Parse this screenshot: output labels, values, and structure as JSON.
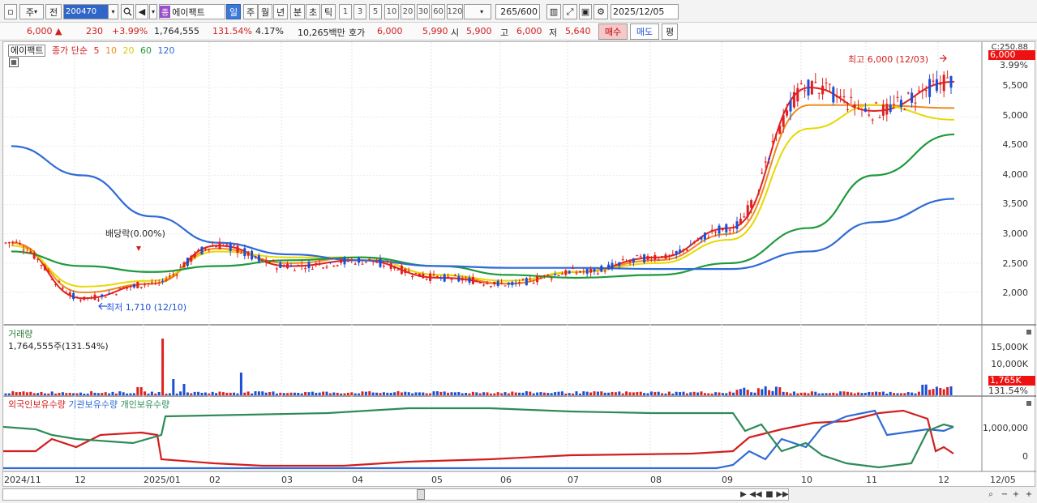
{
  "toolbar": {
    "market_type": "주",
    "prev_label": "전",
    "stock_code": "200470",
    "stock_tag": "종",
    "stock_name": "에이팩트",
    "periods": [
      "일",
      "주",
      "월",
      "년",
      "분",
      "초",
      "틱"
    ],
    "active_period": "일",
    "intervals": [
      "1",
      "3",
      "5",
      "10",
      "20",
      "30",
      "60",
      "120"
    ],
    "count": "265",
    "count_total": "/600",
    "date": "2025/12/05"
  },
  "quote": {
    "price": "6,000",
    "change_arrow": "▲",
    "change": "230",
    "change_pct": "+3.99%",
    "volume": "1,764,555",
    "volume_ratio": "131.54%",
    "turnover_pct": "4.17%",
    "amount": "10,265백만",
    "ask_label": "호가",
    "ask1": "6,000",
    "ask2": "5,990",
    "open_label": "시",
    "open": "5,900",
    "high_label": "고",
    "high": "6,000",
    "low_label": "저",
    "low": "5,640",
    "buy_label": "매수",
    "sell_label": "매도",
    "avg_label": "평"
  },
  "price_panel": {
    "stock_name": "에이팩트",
    "ma_label": "종가 단순",
    "ma_periods": [
      {
        "label": "5",
        "color": "#e02020"
      },
      {
        "label": "10",
        "color": "#f08a1e"
      },
      {
        "label": "20",
        "color": "#e8d800"
      },
      {
        "label": "60",
        "color": "#1e9a3c"
      },
      {
        "label": "120",
        "color": "#2f6bd6"
      }
    ],
    "y_ticks": [
      "5,500",
      "5,000",
      "4,500",
      "4,000",
      "3,500",
      "3,000",
      "2,500",
      "2,000"
    ],
    "current_price_badge": "6,000",
    "current_change_pct": "3.99%",
    "top_right_label": "C:250.88",
    "high_annotation": "최고 6,000 (12/03)",
    "low_annotation": "최저 1,710 (12/10)",
    "dividend_annotation": "배당락(0.00%)"
  },
  "volume_panel": {
    "title": "거래량",
    "value_text": "1,764,555주(131.54%)",
    "y_ticks": [
      "15,000K",
      "10,000K"
    ],
    "badge_value": "1,765K",
    "badge_pct": "131.54%"
  },
  "holding_panel": {
    "series": [
      {
        "label": "외국인보유수량",
        "color": "#d21e1e"
      },
      {
        "label": "기관보유수량",
        "color": "#2f6bd6"
      },
      {
        "label": "개인보유수량",
        "color": "#2e8b57"
      }
    ],
    "y_ticks": [
      "1,000,000",
      "0"
    ]
  },
  "x_axis": {
    "labels": [
      "2024/11",
      "12",
      "2025/01",
      "02",
      "03",
      "04",
      "05",
      "06",
      "07",
      "08",
      "09",
      "10",
      "11",
      "12",
      "12/05"
    ]
  },
  "chart_data": {
    "type": "line",
    "x": [
      "2024/11",
      "12",
      "2025/01",
      "02",
      "03",
      "04",
      "05",
      "06",
      "07",
      "08",
      "09",
      "10",
      "11",
      "12"
    ],
    "series": [
      {
        "name": "5",
        "values": [
          2850,
          1900,
          2150,
          2800,
          2450,
          2550,
          2250,
          2150,
          2350,
          2600,
          3100,
          5500,
          5100,
          5600
        ]
      },
      {
        "name": "10",
        "values": [
          2850,
          2000,
          2150,
          2750,
          2500,
          2600,
          2300,
          2150,
          2350,
          2550,
          3000,
          5200,
          5200,
          5150
        ]
      },
      {
        "name": "20",
        "values": [
          2800,
          2100,
          2200,
          2700,
          2600,
          2600,
          2300,
          2200,
          2350,
          2500,
          2900,
          4800,
          5200,
          4950
        ]
      },
      {
        "name": "60",
        "values": [
          2700,
          2450,
          2350,
          2450,
          2550,
          2600,
          2450,
          2300,
          2250,
          2300,
          2500,
          3100,
          4000,
          4700
        ]
      },
      {
        "name": "120",
        "values": [
          4500,
          4000,
          3300,
          2850,
          2650,
          2550,
          2450,
          2420,
          2420,
          2400,
          2400,
          2700,
          3200,
          3600
        ]
      }
    ],
    "ylim": [
      1710,
      6000
    ]
  }
}
